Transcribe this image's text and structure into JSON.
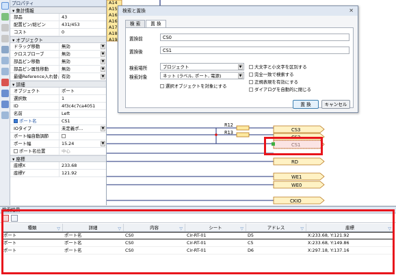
{
  "properties": {
    "title": "プロパティ",
    "sections": [
      {
        "label": "集計情報",
        "rows": [
          {
            "key": "部品",
            "value": "43"
          },
          {
            "key": "配置ピン/総ピン",
            "value": "431/453"
          },
          {
            "key": "コスト",
            "value": "0"
          }
        ]
      },
      {
        "label": "オプジェクト",
        "rows": [
          {
            "key": "ドラッグ移動",
            "value": "無効"
          },
          {
            "key": "クロスプローブ",
            "value": "無効"
          },
          {
            "key": "部品ピン移動",
            "value": "無効"
          },
          {
            "key": "部品ピン属性移動",
            "value": "無効"
          },
          {
            "key": "最優Reference入れ替え",
            "value": "有効"
          }
        ]
      },
      {
        "label": "詳細",
        "rows": [
          {
            "key": "オブジェクト",
            "value": "ポート"
          },
          {
            "key": "選択数",
            "value": "1"
          },
          {
            "key": "ID",
            "value": "4f3c4c7ca4051"
          },
          {
            "key": "名前",
            "value": "Left"
          },
          {
            "key": "ポート名",
            "value": "CS1"
          },
          {
            "key": "IOタイプ",
            "value": "未定義ポ..."
          },
          {
            "key": "ポート幅自動調節",
            "value": ""
          },
          {
            "key": "ポート幅",
            "value": "15.24"
          },
          {
            "key": "ポート名位置",
            "value": "中心"
          }
        ]
      },
      {
        "label": "座標",
        "rows": [
          {
            "key": "座標X",
            "value": "233.68"
          },
          {
            "key": "座標Y",
            "value": "121.92"
          }
        ]
      }
    ]
  },
  "canvas": {
    "top_labels": [
      "A14",
      "A15",
      "A16",
      "A16",
      "A17",
      "A18",
      "A19"
    ],
    "resistors": [
      "R12",
      "R13"
    ],
    "ports": [
      "CS3",
      "CS2",
      "CS1",
      "RD",
      "WE1",
      "WE0",
      "CKIO"
    ]
  },
  "dialog": {
    "title": "検索と置換",
    "close": "✕",
    "tabs": [
      "検 索",
      "置 換"
    ],
    "find_label": "置換前",
    "find_value": "CS0",
    "replace_label": "置換後",
    "replace_value": "CS1",
    "location_label": "検索場所",
    "location_value": "プロジェクト",
    "target_label": "検索対象",
    "target_value": "ネット (ラベル, ポート, 電源)",
    "selected_only": "選択オブジェクトを対象にする",
    "options": [
      "大文字と小文字を区別する",
      "完全一致で検索する",
      "正規表現を有効にする",
      "ダイアログを自動的に閉じる"
    ],
    "replace_button": "置 換",
    "cancel_button": "キャンセル"
  },
  "results": {
    "title": "検索結果",
    "columns": [
      "種類",
      "詳細",
      "内容",
      "シート",
      "アドレス",
      "座標"
    ],
    "rows": [
      [
        "ポート",
        "ポート名",
        "CS0",
        "Cir-RT-01",
        "D5",
        "X:233.68, Y:121.92"
      ],
      [
        "ポート",
        "ポート名",
        "CS0",
        "Cir-RT-01",
        "C5",
        "X:233.68, Y:149.86"
      ],
      [
        "ポート",
        "ポート名",
        "CS0",
        "Cir-RT-01",
        "D6",
        "X:297.18, Y:137.16"
      ]
    ]
  },
  "colors": {
    "highlight": "#e8141b",
    "port_fill": "#fff2c4",
    "port_stroke": "#b8761a",
    "wire": "#1c2f7a",
    "resistor_fill": "#fde9a0",
    "via": "#e01010"
  }
}
